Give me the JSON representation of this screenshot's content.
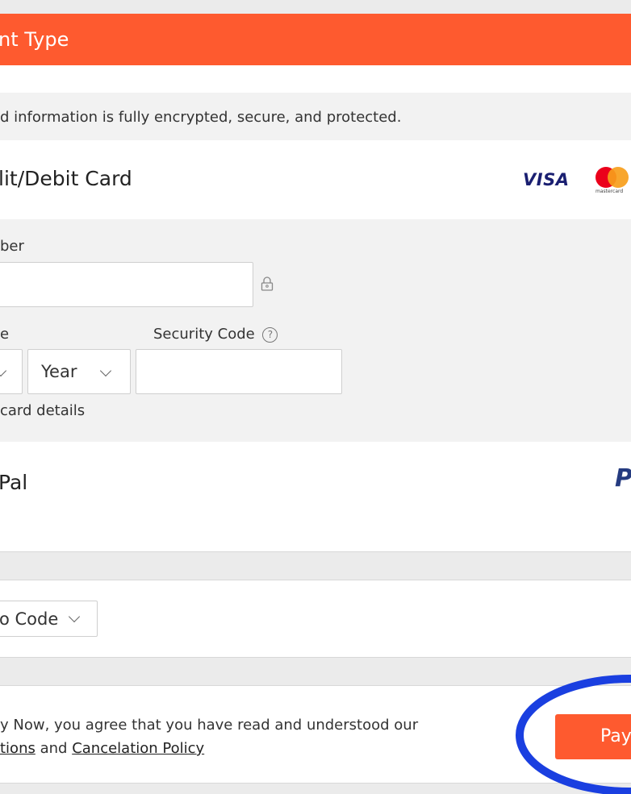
{
  "header": {
    "title": "nt Type"
  },
  "secure_note": "d information is fully encrypted, secure, and protected.",
  "card_option": {
    "label": "lit/Debit Card",
    "visa_logo": "VISA",
    "mastercard_caption": "mastercard"
  },
  "card_form": {
    "number_label": "ber",
    "number_value": "",
    "expiry_label": "e",
    "year_select": "Year",
    "security_label": "Security Code",
    "security_help": "?",
    "security_value": "",
    "footer_text": "card details"
  },
  "paypal_option": {
    "label": "Pal",
    "logo": "P"
  },
  "promo": {
    "label": "o Code"
  },
  "agreement": {
    "line1": "y Now, you agree that you have read and understood our",
    "terms_link": "tions",
    "connector": "and",
    "policy_link": "Cancelation Policy"
  },
  "pay_button": {
    "label": "Pay"
  },
  "colors": {
    "accent": "#fe5a2f",
    "annotation_circle": "#1a3fe0",
    "visa": "#1a1f71",
    "mastercard_red": "#eb001b",
    "mastercard_orange": "#f79e1b"
  },
  "icons": {
    "lock": "lock-icon",
    "help": "help-circle-icon",
    "chevron": "chevron-down-icon"
  }
}
